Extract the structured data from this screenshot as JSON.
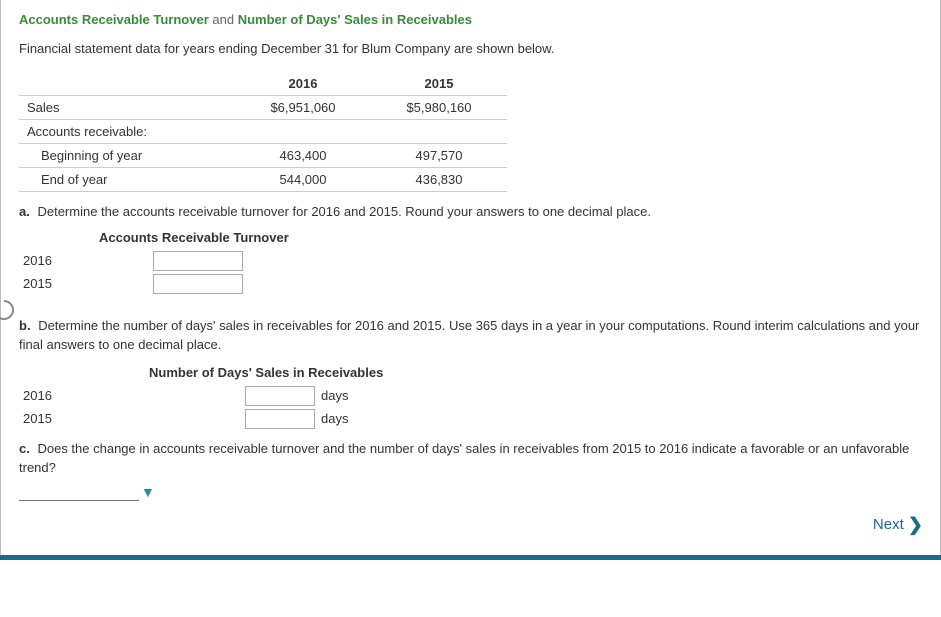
{
  "title": {
    "part1": "Accounts Receivable Turnover",
    "joiner": " and ",
    "part2": "Number of Days' Sales in Receivables"
  },
  "intro": "Financial statement data for years ending December 31 for Blum Company are shown below.",
  "cols": {
    "c1": "2016",
    "c2": "2015"
  },
  "rows": {
    "sales": {
      "label": "Sales",
      "v1": "$6,951,060",
      "v2": "$5,980,160"
    },
    "arhead": {
      "label": "Accounts receivable:"
    },
    "boy": {
      "label": "Beginning of year",
      "v1": "463,400",
      "v2": "497,570"
    },
    "eoy": {
      "label": "End of year",
      "v1": "544,000",
      "v2": "436,830"
    }
  },
  "qa": {
    "label": "a.",
    "text": "Determine the accounts receivable turnover for 2016 and 2015. Round your answers to one decimal place.",
    "heading": "Accounts Receivable Turnover",
    "y1": "2016",
    "y2": "2015"
  },
  "qb": {
    "label": "b.",
    "text": "Determine the number of days' sales in receivables for 2016 and 2015. Use 365 days in a year in your computations. Round interim calculations and your final answers to one decimal place.",
    "heading": "Number of Days' Sales in Receivables",
    "y1": "2016",
    "y2": "2015",
    "unit": "days"
  },
  "qc": {
    "label": "c.",
    "text": "Does the change in accounts receivable turnover and the number of days' sales in receivables from 2015 to 2016 indicate a favorable or an unfavorable trend?"
  },
  "nav": {
    "next": "Next"
  }
}
